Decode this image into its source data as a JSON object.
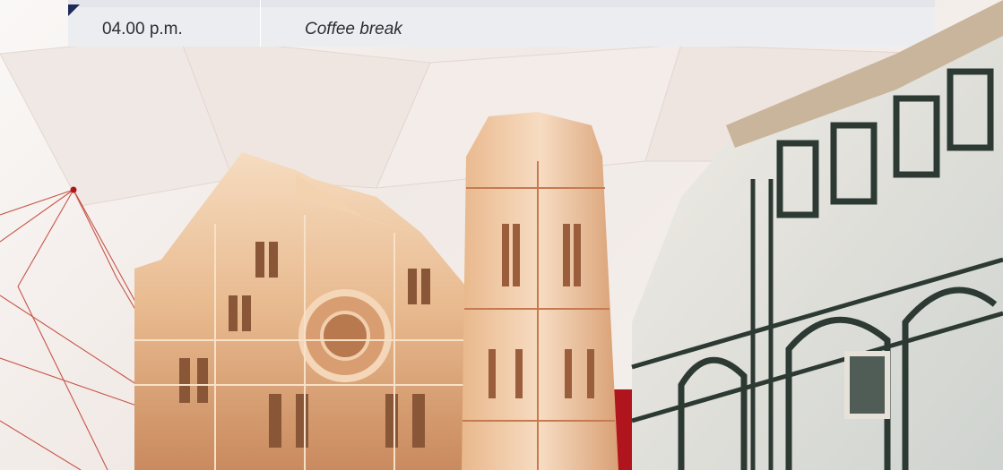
{
  "schedule": {
    "rows": [
      {
        "time": "04.00 p.m.",
        "event": "Coffee break"
      }
    ]
  },
  "illustration": {
    "subject": "florence-cathedral-illustration",
    "accent_color": "#b0141c",
    "navy_color": "#1f2a5a"
  }
}
